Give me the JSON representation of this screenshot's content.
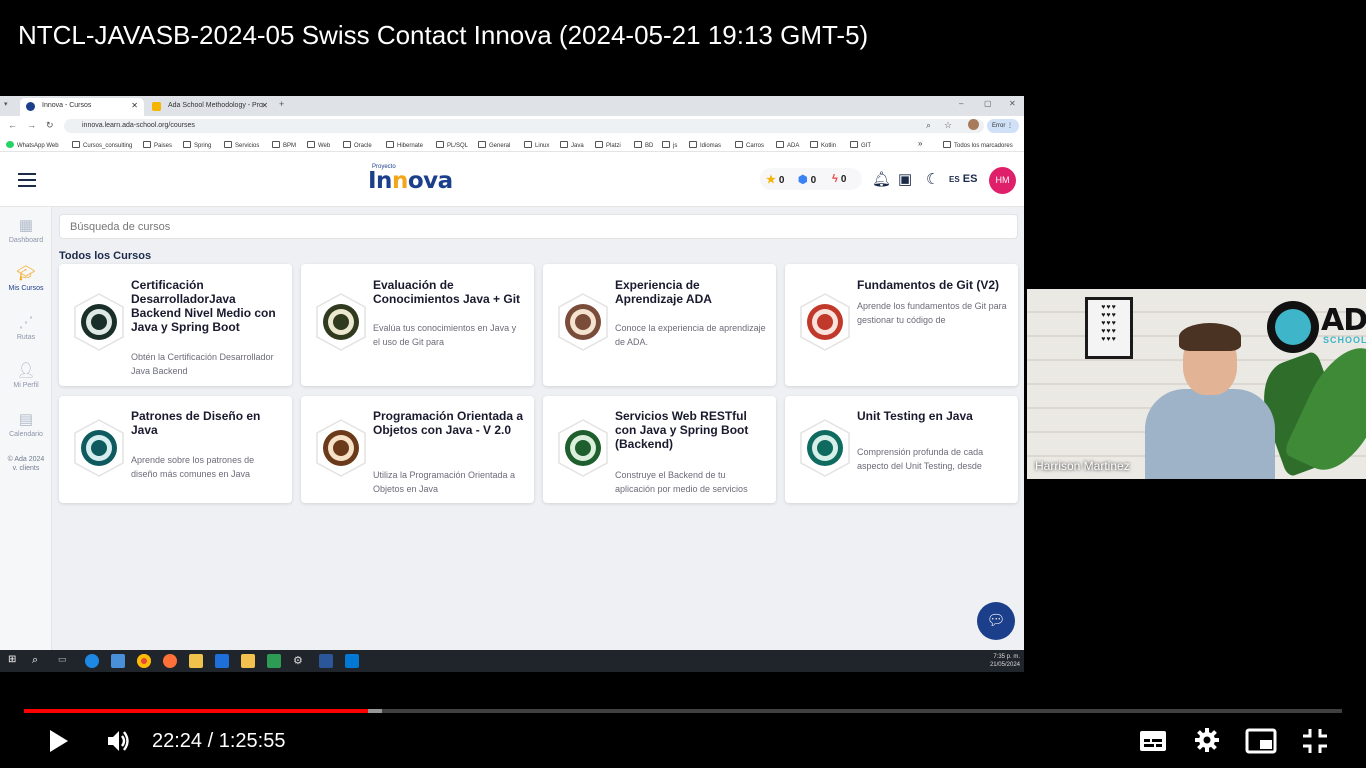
{
  "video": {
    "title": "NTCL-JAVASB-2024-05 Swiss Contact Innova (2024-05-21 19:13 GMT-5)",
    "current_time": "22:24",
    "separator": " / ",
    "duration": "1:25:55",
    "progress_played_pct": 26.1,
    "progress_loaded_pct": 27.2,
    "accent_color": "#ff0000"
  },
  "browser": {
    "tabs": [
      {
        "label": "Innova - Cursos",
        "active": true,
        "close": "✕"
      },
      {
        "label": "Ada School Methodology - Pro",
        "active": false,
        "close": "✕"
      }
    ],
    "new_tab": "+",
    "url": "innova.learn.ada-school.org/courses",
    "error_label": "Error",
    "window_controls": {
      "minimize": "–",
      "maximize": "▢",
      "close": "✕"
    },
    "bookmarks": [
      "WhatsApp Web",
      "Cursos_consulting",
      "Paises",
      "Spring",
      "Servicios",
      "BPM",
      "Web",
      "Oracle",
      "Hibernate",
      "PL/SQL",
      "General",
      "Linux",
      "Java",
      "Platzi",
      "BD",
      "js",
      "Idiomas",
      "Carros",
      "ADA",
      "Kotlin",
      "GIT"
    ],
    "bookmarks_more": "»",
    "all_bookmarks": "Todos los marcadores"
  },
  "app": {
    "logo_top": "Proyecto",
    "logo_a": "In",
    "logo_b": "n",
    "logo_c": "ova",
    "counters": {
      "stars": "0",
      "gems": "0",
      "bolts": "0"
    },
    "lang_flag": "ES",
    "lang": "ES",
    "avatar_initials": "HM",
    "search_placeholder": "Búsqueda de cursos",
    "section_title": "Todos los Cursos",
    "sidebar": [
      {
        "label": "Dashboard",
        "icon": "dashboard-icon"
      },
      {
        "label": "Mis Cursos",
        "icon": "graduation-cap-icon"
      },
      {
        "label": "Rutas",
        "icon": "route-icon"
      },
      {
        "label": "Mi Perfil",
        "icon": "user-icon"
      },
      {
        "label": "Calendario",
        "icon": "calendar-icon"
      }
    ],
    "footer_line1": "© Ada 2024",
    "footer_line2": "v. clients",
    "courses": [
      {
        "title": "Certificación DesarrolladorJava Backend Nivel Medio con Java y Spring Boot",
        "desc": "Obtén la Certificación Desarrollador Java Backend"
      },
      {
        "title": "Evaluación de Conocimientos Java + Git",
        "desc": "Evalúa tus conocimientos en Java y el uso de Git para"
      },
      {
        "title": "Experiencia de Aprendizaje ADA",
        "desc": "Conoce la experiencia de aprendizaje de ADA."
      },
      {
        "title": "Fundamentos de Git (V2)",
        "desc": "Aprende los fundamentos de Git para gestionar tu código de"
      },
      {
        "title": "Patrones de Diseño en Java",
        "desc": "Aprende sobre los patrones de diseño más comunes en Java"
      },
      {
        "title": "Programación Orientada a Objetos con Java - V 2.0",
        "desc": "Utiliza la Programación Orientada a Objetos en Java"
      },
      {
        "title": "Servicios Web RESTful con Java y Spring Boot (Backend)",
        "desc": "Construye el Backend de tu aplicación por medio de servicios"
      },
      {
        "title": "Unit Testing en Java",
        "desc": "Comprensión profunda de cada aspecto del Unit Testing, desde"
      }
    ]
  },
  "taskbar": {
    "time": "7:35 p. m.",
    "date": "21/05/2024"
  },
  "webcam": {
    "name": "Harrison Martinez",
    "logo_text": "ADA",
    "logo_sub": "SCHOOL"
  }
}
